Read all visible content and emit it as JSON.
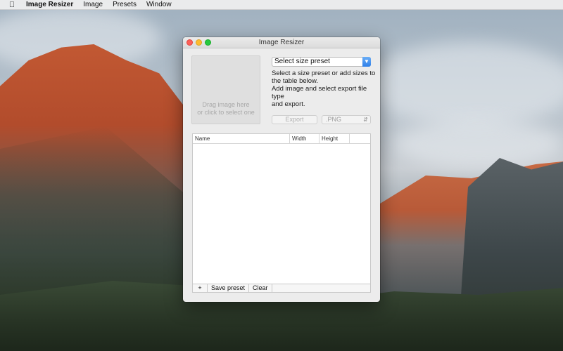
{
  "menubar": {
    "apple_icon": "apple-logo",
    "app_name": "Image Resizer",
    "menus": [
      "Image",
      "Presets",
      "Window"
    ]
  },
  "window": {
    "title": "Image Resizer",
    "dropzone": {
      "line1": "Drag image here",
      "line2": "or click to select one"
    },
    "preset_select": {
      "selected": "Select size preset",
      "arrow_icon": "chevron-down-icon"
    },
    "instructions": {
      "line1": "Select a size preset or add sizes to",
      "line2": "the table below.",
      "line3": "Add image and select export file type",
      "line4": "and export."
    },
    "export_label": "Export",
    "file_type": {
      "selected": ".PNG",
      "stepper_icon": "up-down-chevron-icon"
    },
    "table": {
      "columns": [
        "Name",
        "Width",
        "Height"
      ],
      "rows": []
    },
    "bottom_bar": {
      "add_label": "+",
      "save_label": "Save preset",
      "clear_label": "Clear"
    }
  },
  "colors": {
    "close": "#fd5f57",
    "minimize": "#fdbc2e",
    "maximize": "#28c840",
    "accent": "#2f7fe9"
  }
}
